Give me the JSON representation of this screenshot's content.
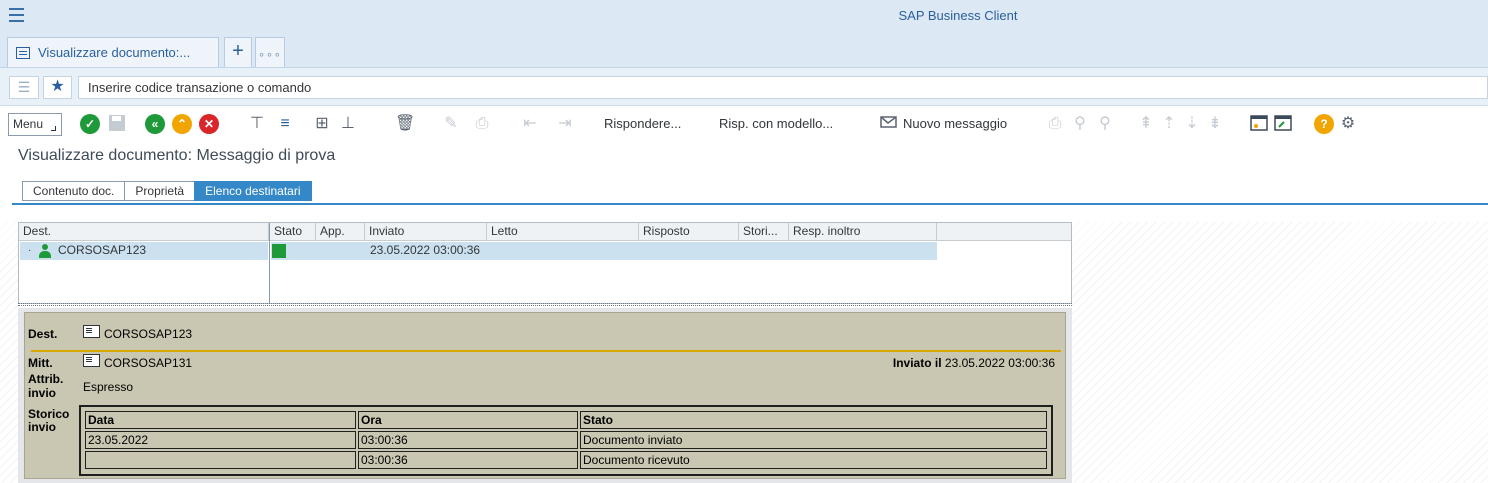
{
  "app": {
    "title": "SAP Business Client"
  },
  "tabs_bar": {
    "doc_tab_label": "Visualizzare documento:...",
    "add_label": "+",
    "more_label": "∘∘∘"
  },
  "command": {
    "placeholder": "Inserire codice transazione o comando"
  },
  "toolbar": {
    "menu_label": "Menu",
    "reply_label": "Rispondere...",
    "reply_template_label": "Risp. con modello...",
    "new_message_label": "Nuovo messaggio"
  },
  "page": {
    "title": "Visualizzare documento: Messaggio di prova"
  },
  "view_tabs": [
    {
      "label": "Contenuto doc.",
      "active": false
    },
    {
      "label": "Proprietà",
      "active": false
    },
    {
      "label": "Elenco destinatari",
      "active": true
    }
  ],
  "grid": {
    "columns": [
      "Dest.",
      "Stato",
      "App.",
      "Inviato",
      "Letto",
      "Risposto",
      "Stori...",
      "Resp. inoltro"
    ],
    "rows": [
      {
        "dest": "CORSOSAP123",
        "status_color": "#1e9a3a",
        "sent": "23.05.2022 03:00:36",
        "read": "",
        "replied": ""
      }
    ]
  },
  "detail": {
    "dest_label": "Dest.",
    "dest_value": "CORSOSAP123",
    "from_label": "Mitt.",
    "from_value": "CORSOSAP131",
    "sent_on_label": "Inviato il",
    "sent_on_value": "23.05.2022 03:00:36",
    "attr_label_1": "Attrib.",
    "attr_label_2": "invio",
    "attr_value": "Espresso",
    "history_label_1": "Storico",
    "history_label_2": "invio",
    "history": {
      "headers": [
        "Data",
        "Ora",
        "Stato"
      ],
      "rows": [
        [
          "23.05.2022",
          "03:00:36",
          "Documento inviato"
        ],
        [
          "",
          "03:00:36",
          "Documento ricevuto"
        ]
      ]
    }
  },
  "colors": {
    "accent": "#3588c8",
    "brand_blue": "#2b5f9e",
    "panel": "#c9c6b2",
    "divider_gold": "#d8a800",
    "ok_green": "#1e9a3a"
  },
  "icons": [
    "menu-icon",
    "document-icon",
    "list-icon",
    "star-icon",
    "check-icon",
    "save-icon",
    "back-icon",
    "up-icon",
    "cancel-icon",
    "filter-icon",
    "help-icon",
    "settings-icon",
    "user-icon"
  ]
}
